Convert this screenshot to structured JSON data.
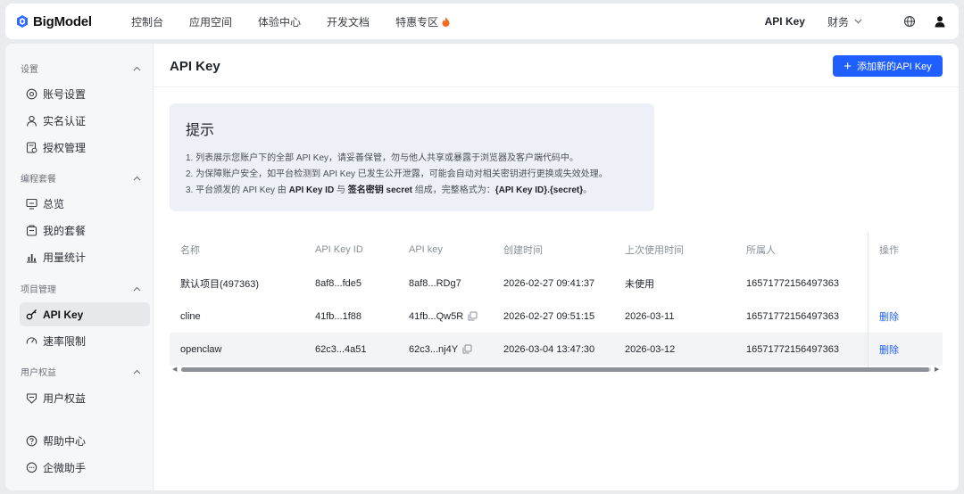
{
  "brand": {
    "name": "BigModel",
    "color": "#1f5eff"
  },
  "nav": [
    {
      "label": "控制台"
    },
    {
      "label": "应用空间"
    },
    {
      "label": "体验中心"
    },
    {
      "label": "开发文档"
    },
    {
      "label": "特惠专区",
      "icon": "fire-icon"
    }
  ],
  "topright": {
    "apikey": "API Key",
    "finance": "财务"
  },
  "sidebar": {
    "sections": [
      {
        "title": "设置",
        "items": [
          {
            "label": "账号设置",
            "icon": "settings-icon"
          },
          {
            "label": "实名认证",
            "icon": "user-icon"
          },
          {
            "label": "授权管理",
            "icon": "authorization-icon"
          }
        ]
      },
      {
        "title": "编程套餐",
        "items": [
          {
            "label": "总览",
            "icon": "monitor-icon"
          },
          {
            "label": "我的套餐",
            "icon": "package-icon"
          },
          {
            "label": "用量统计",
            "icon": "bar-chart-icon"
          }
        ]
      },
      {
        "title": "项目管理",
        "items": [
          {
            "label": "API Key",
            "icon": "key-icon",
            "active": true
          },
          {
            "label": "速率限制",
            "icon": "speed-icon"
          }
        ]
      },
      {
        "title": "用户权益",
        "items": [
          {
            "label": "用户权益",
            "icon": "benefits-icon"
          }
        ]
      }
    ],
    "bottom": [
      {
        "label": "帮助中心",
        "icon": "help-icon"
      },
      {
        "label": "企微助手",
        "icon": "chat-icon"
      }
    ]
  },
  "main": {
    "title": "API Key",
    "add_button": "添加新的API Key",
    "tip": {
      "title": "提示",
      "line1": "1. 列表展示您账户下的全部 API Key，请妥善保管，勿与他人共享或暴露于浏览器及客户端代码中。",
      "line2": "2. 为保障账户安全，如平台检测到 API Key 已发生公开泄露，可能会自动对相关密钥进行更换或失效处理。",
      "line3_a": "3. 平台颁发的 API Key 由 ",
      "line3_b": "API Key ID",
      "line3_c": " 与 ",
      "line3_d": "签名密钥 secret",
      "line3_e": " 组成，完整格式为：",
      "line3_f": "{API Key ID}.{secret}",
      "line3_g": "。"
    },
    "table": {
      "headers": [
        "名称",
        "API Key ID",
        "API key",
        "创建时间",
        "上次使用时间",
        "所属人",
        "操作"
      ],
      "rows": [
        {
          "name": "默认项目(497363)",
          "key_id": "8af8...fde5",
          "key": "8af8...RDg7",
          "created": "2026-02-27 09:41:37",
          "last_used": "未使用",
          "owner": "16571772156497363",
          "action": "",
          "copy": false
        },
        {
          "name": "cline",
          "key_id": "41fb...1f88",
          "key": "41fb...Qw5R",
          "created": "2026-02-27 09:51:15",
          "last_used": "2026-03-11",
          "owner": "16571772156497363",
          "action": "删除",
          "copy": true
        },
        {
          "name": "openclaw",
          "key_id": "62c3...4a51",
          "key": "62c3...nj4Y",
          "created": "2026-03-04 13:47:30",
          "last_used": "2026-03-12",
          "owner": "16571772156497363",
          "action": "删除",
          "copy": true
        }
      ]
    }
  }
}
